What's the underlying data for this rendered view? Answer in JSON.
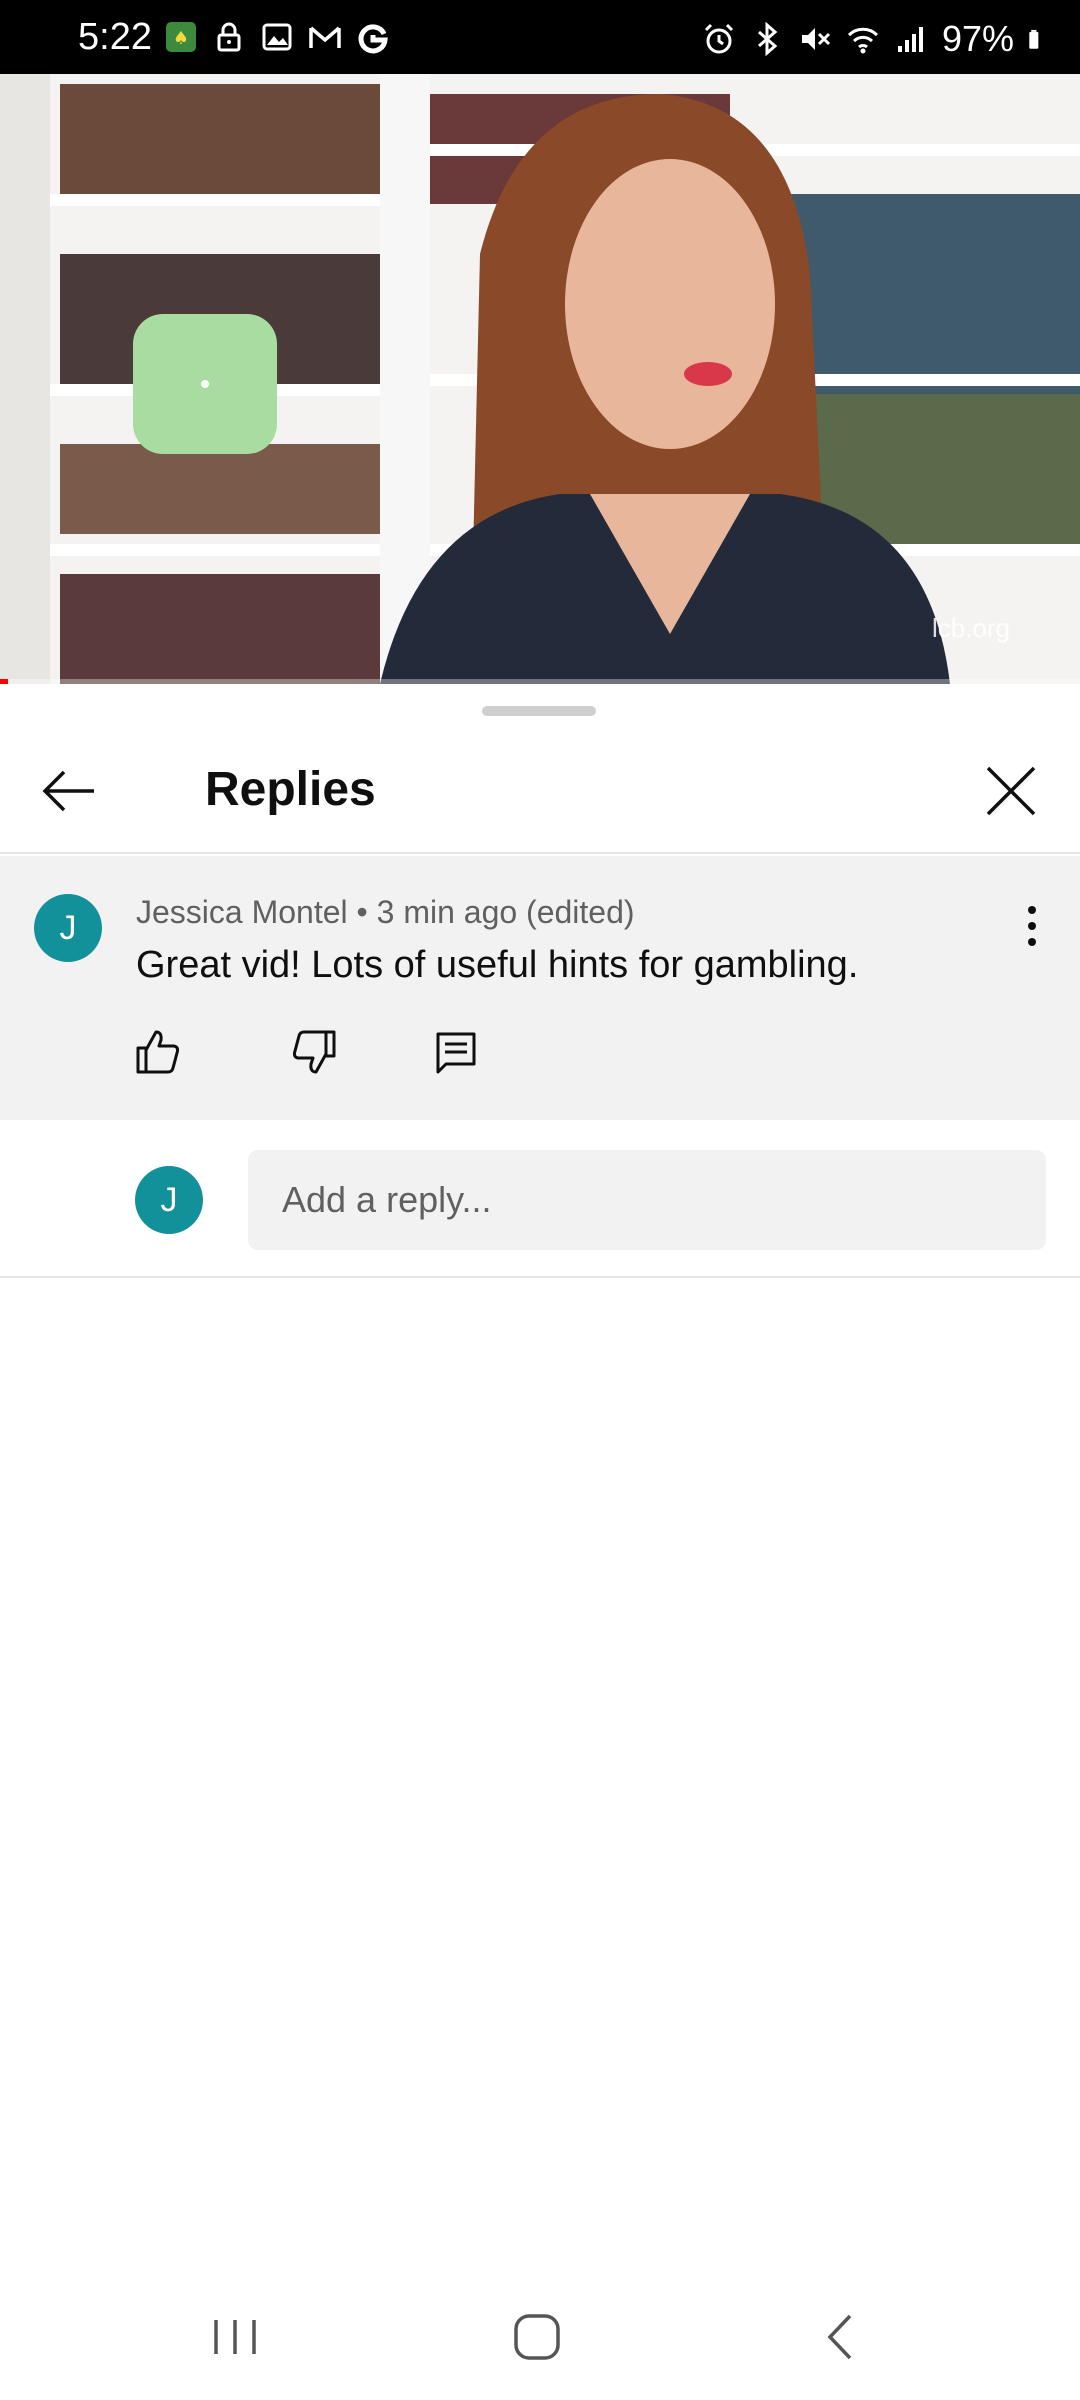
{
  "status_bar": {
    "time": "5:22",
    "battery": "97%",
    "left_icons": [
      "game-app-icon",
      "lock-icon",
      "image-icon",
      "gmail-icon",
      "google-icon"
    ],
    "right_icons": [
      "alarm-icon",
      "bluetooth-icon",
      "mute-icon",
      "wifi-icon",
      "signal-icon",
      "battery-icon"
    ]
  },
  "video": {
    "watermark": "lcb.org"
  },
  "sheet": {
    "title": "Replies",
    "back_icon": "arrow-left-icon",
    "close_icon": "close-icon"
  },
  "comment": {
    "avatar_letter": "J",
    "meta": "Jessica Montel • 3 min ago (edited)",
    "text": "Great vid! Lots of useful hints for gambling.",
    "actions": [
      "like-icon",
      "dislike-icon",
      "reply-icon"
    ]
  },
  "reply_box": {
    "avatar_letter": "J",
    "placeholder": "Add a reply..."
  },
  "colors": {
    "avatar": "#13919b",
    "comment_bg": "#f2f2f2",
    "progress": "#ff0000"
  }
}
